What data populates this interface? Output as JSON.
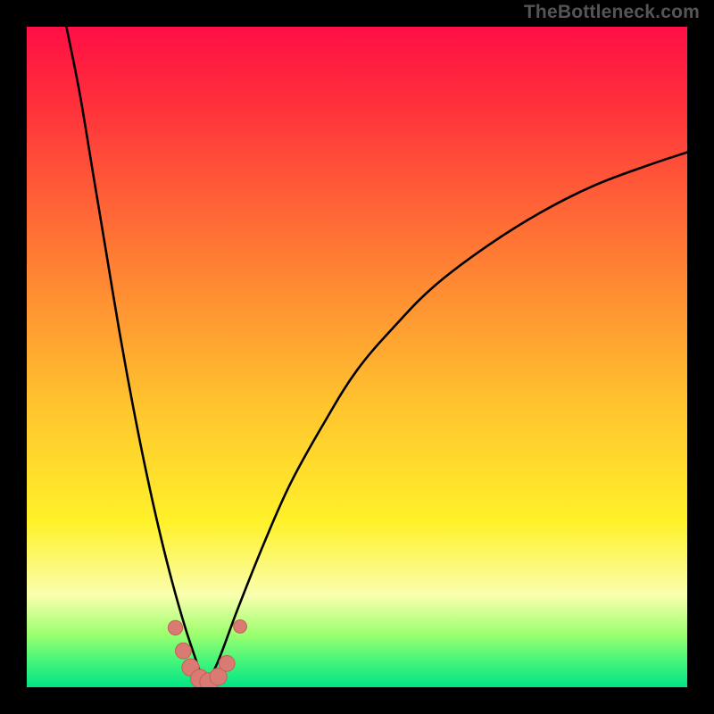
{
  "attribution": "TheBottleneck.com",
  "colors": {
    "black": "#000000",
    "text": "#555558",
    "curve": "#000000",
    "marker_fill": "#d97a73",
    "marker_stroke": "#c46058",
    "grad_top": "#ff0f46",
    "grad_red": "#ff2b3c",
    "grad_orange": "#ff7d34",
    "grad_yellowish": "#ffc62e",
    "grad_yellow": "#fff12a",
    "grad_pale": "#faffae",
    "grad_lime": "#9cff6f",
    "grad_green_mid": "#46f57a",
    "grad_green": "#00e585"
  },
  "chart_data": {
    "type": "line",
    "title": "",
    "xlabel": "",
    "ylabel": "",
    "xlim": [
      0,
      100
    ],
    "ylim": [
      0,
      100
    ],
    "notes": "V-shaped bottleneck curve on heatmap-style vertical gradient (red high → green low). Minimum at x≈27, y≈0. Scattered pink markers clustered near the minimum. No tick labels, legend, or numeric axis labels are visible in the image; values are estimated from position.",
    "series": [
      {
        "name": "left-branch",
        "x": [
          6,
          8,
          10,
          12,
          14,
          16,
          18,
          20,
          22,
          24,
          26,
          27
        ],
        "values": [
          100,
          90,
          78,
          66,
          54,
          43,
          33,
          24,
          16,
          9,
          3,
          0
        ]
      },
      {
        "name": "right-branch",
        "x": [
          27,
          29,
          32,
          36,
          40,
          45,
          50,
          56,
          62,
          70,
          78,
          86,
          94,
          100
        ],
        "values": [
          0,
          4,
          12,
          22,
          31,
          40,
          48,
          55,
          61,
          67,
          72,
          76,
          79,
          81
        ]
      }
    ],
    "markers": [
      {
        "x": 22.5,
        "y": 9.0,
        "r": 1.1
      },
      {
        "x": 23.7,
        "y": 5.5,
        "r": 1.2
      },
      {
        "x": 24.8,
        "y": 3.0,
        "r": 1.3
      },
      {
        "x": 26.2,
        "y": 1.3,
        "r": 1.4
      },
      {
        "x": 27.6,
        "y": 0.8,
        "r": 1.4
      },
      {
        "x": 29.0,
        "y": 1.6,
        "r": 1.3
      },
      {
        "x": 30.3,
        "y": 3.6,
        "r": 1.2
      },
      {
        "x": 32.3,
        "y": 9.2,
        "r": 1.0
      }
    ]
  }
}
